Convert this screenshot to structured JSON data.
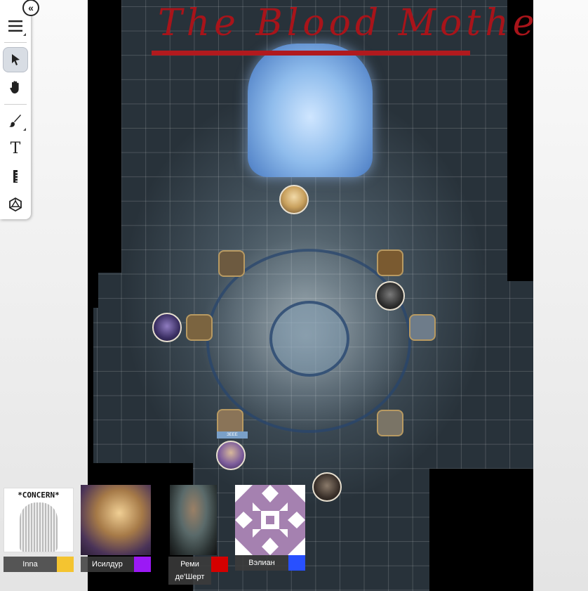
{
  "map": {
    "title": "The Blood Mother",
    "title_color": "#a8141a",
    "token_label": "ЗЕЕЕ"
  },
  "toolbar": {
    "collapse_icon": "double-chevron-left-icon",
    "tools": [
      {
        "name": "menu-icon",
        "active": false
      },
      {
        "name": "select-pointer-icon",
        "active": true
      },
      {
        "name": "pan-hand-icon",
        "active": false
      },
      {
        "name": "brush-icon",
        "active": false
      },
      {
        "name": "text-tool-icon",
        "active": false
      },
      {
        "name": "ruler-icon",
        "active": false
      },
      {
        "name": "dice-icon",
        "active": false
      }
    ]
  },
  "players": [
    {
      "name": "Inna",
      "color": "#f4c430",
      "portrait_text": "*CONCERN*"
    },
    {
      "name": "Исилдур",
      "color": "#9b19f5"
    },
    {
      "name": "Реми де'Шерт",
      "color": "#d40000"
    },
    {
      "name": "Вэлиан",
      "color": "#2850ff"
    }
  ]
}
